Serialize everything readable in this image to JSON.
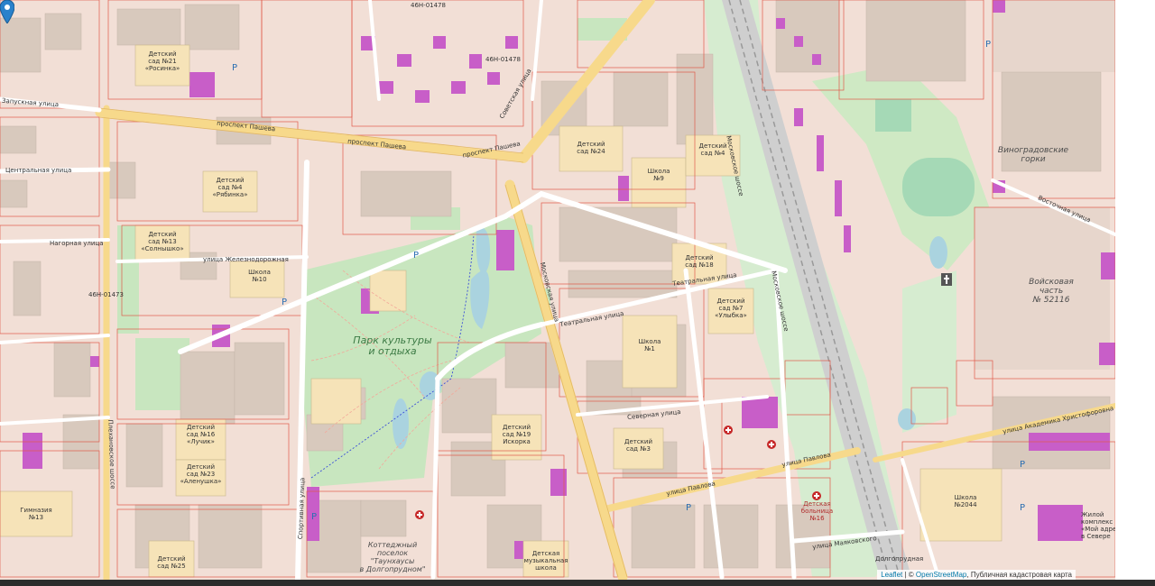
{
  "map": {
    "road_labels": {
      "pashchova_1": "проспект Пашева",
      "pashchova_2": "проспект Пашева",
      "pashchova_3": "проспект Пашева",
      "zapusk": "Запускная улица",
      "central": "Центральная улица",
      "nagornaya": "Нагорная улица",
      "zheleznodorozh": "улица Железнодорожная",
      "teatralnaya_1": "Театральная улица",
      "teatralnaya_2": "Театральная улица",
      "severnaya": "Северная улица",
      "pavlova_1": "улица Павлова",
      "pavlova_2": "улица Павлова",
      "mayakovskogo": "улица Маяковского",
      "dolgoprudnaya": "Долгопрудная",
      "hristoforovna": "улица Академика Христофоровна",
      "vostochnaya": "Восточная улица",
      "moskovskoe": "Московское шоссе",
      "moskovskoe_2": "Московское шоссе",
      "sportivnaya": "Спортивная улица",
      "sovetskaya": "Советская улица",
      "plehanova": "Плехановское шоссе",
      "moskovskaya": "Московская улица",
      "r_01478_a": "46Н-01478",
      "r_01478_b": "46Н-01478",
      "r_01473": "46Н-01473"
    },
    "places": {
      "park": "Парк культуры\nи отдыха",
      "vinogradovskie": "Виноградовские\nгорки",
      "military": "Войсковая\nчасть\n№ 52116",
      "cottage": "Коттеджный\nпоселок\n\"Таунхаусы\nв Долгопрудном\""
    },
    "facilities": {
      "ds21": "Детский\nсад №21\n«Росинка»",
      "ds4": "Детский\nсад №4\n«Рябинка»",
      "ds13": "Детский\nсад №13\n«Солнышко»",
      "school10": "Школа\n№10",
      "ds24": "Детский\nсад №24",
      "school9": "Школа\n№9",
      "ds4b": "Детский\nсад №4",
      "ds18": "Детский\nсад №18",
      "ds7": "Детский\nсад №7\n«Улыбка»",
      "school1": "Школа\n№1",
      "ds19": "Детский\nсад №19\nИскорка",
      "ds3": "Детский\nсад №3",
      "ds16": "Детский\nсад №16\n«Лучик»",
      "ds23": "Детский\nсад №23\n«Аленушка»",
      "gymn13": "Гимназия\n№13",
      "ds25": "Детский\nсад №25",
      "school2044": "Школа\n№2044",
      "music_school": "Детская\nмузыкальная\nшкола",
      "hospital": "Детская\nбольница\n№16",
      "zhk": "Жилой\nкомплекс\n«Мой адрес»\nв Севере"
    },
    "marker_label": "location-pin"
  },
  "attribution": {
    "leaflet": "Leaflet",
    "sep": " | © ",
    "osm": "OpenStreetMap",
    "rest": ", Публичная кадастровая карта"
  },
  "colors": {
    "background": "#f2dfd6",
    "park": "#c8e6bf",
    "water": "#aad3df",
    "building": "#d8c9bd",
    "purple_building": "#c85ec8",
    "main_road": "#f7d98b",
    "parcel_line": "#e05a4a",
    "marker": "#2a81cb"
  }
}
